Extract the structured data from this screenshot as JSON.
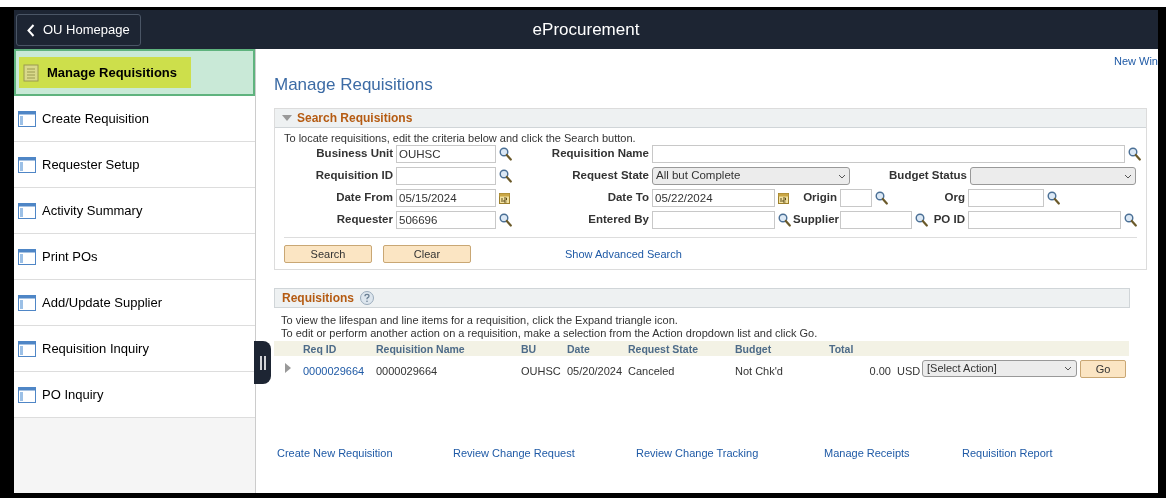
{
  "header": {
    "back_button": "OU Homepage",
    "title": "eProcurement"
  },
  "sidebar": {
    "items": [
      {
        "label": "Manage Requisitions",
        "selected": true
      },
      {
        "label": "Create Requisition",
        "selected": false
      },
      {
        "label": "Requester Setup",
        "selected": false
      },
      {
        "label": "Activity Summary",
        "selected": false
      },
      {
        "label": "Print POs",
        "selected": false
      },
      {
        "label": "Add/Update Supplier",
        "selected": false
      },
      {
        "label": "Requisition Inquiry",
        "selected": false
      },
      {
        "label": "PO Inquiry",
        "selected": false
      }
    ]
  },
  "new_window_link": "New Win",
  "page_title": "Manage Requisitions",
  "search": {
    "title": "Search Requisitions",
    "expanded": true,
    "instructions": "To locate requisitions, edit the criteria below and click the Search button.",
    "rows": [
      [
        {
          "label": "Business Unit",
          "value": "OUHSC",
          "kind": "lookup"
        },
        {
          "label": "Requisition Name",
          "kind": "lookup"
        }
      ],
      [
        {
          "label": "Requisition ID",
          "kind": "lookup"
        },
        {
          "label": "Request State",
          "value": "All but Complete",
          "kind": "select"
        },
        {
          "kind": "empty"
        },
        {
          "label": "Budget Status",
          "kind": "select"
        }
      ],
      [
        {
          "label": "Date From",
          "value": "05/15/2024",
          "kind": "date"
        },
        {
          "label": "Date To",
          "value": "05/22/2024",
          "kind": "date"
        },
        {
          "label": "Origin",
          "kind": "lookup"
        },
        {
          "label": "Org",
          "kind": "lookup"
        }
      ],
      [
        {
          "label": "Requester",
          "value": "506696",
          "kind": "lookup"
        },
        {
          "label": "Entered By",
          "kind": "lookup"
        },
        {
          "label": "Supplier",
          "kind": "lookup"
        },
        {
          "label": "PO ID",
          "kind": "lookup"
        }
      ]
    ],
    "buttons": [
      "Search",
      "Clear"
    ],
    "advanced_link": "Show Advanced Search"
  },
  "requisitions": {
    "title": "Requisitions",
    "instructions": [
      "To view the lifespan and line items for a requisition, click the Expand triangle icon.",
      "To edit or perform another action on a requisition, make a selection from the Action dropdown list and click Go."
    ],
    "columns": [
      "Req ID",
      "Requisition Name",
      "BU",
      "Date",
      "Request State",
      "Budget",
      "Total"
    ],
    "rows": [
      {
        "req_id": "0000029664",
        "name": "0000029664",
        "bu": "OUHSC",
        "date": "05/20/2024",
        "state": "Canceled",
        "budget": "Not Chk'd",
        "total": "0.00",
        "currency": "USD",
        "action": "[Select Action]",
        "go": "Go",
        "expanded": false
      }
    ]
  },
  "footer_links": [
    "Create New Requisition",
    "Review Change Request",
    "Review Change Tracking",
    "Manage Receipts",
    "Requisition Report"
  ]
}
